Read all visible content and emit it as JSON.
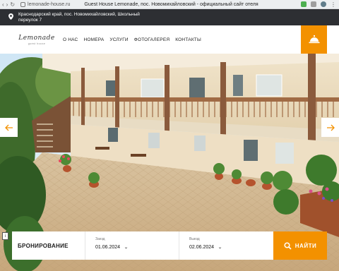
{
  "browser": {
    "url": "lemonade-house.ru",
    "tab_title": "Guest House Lemonade, пос. Новомихайловский - официальный сайт отеля"
  },
  "infobar": {
    "address": "Краснодарский край, пос. Новомихайловский, Школьный переулок 7"
  },
  "logo": {
    "brand": "Lemonade",
    "sub": "guest house"
  },
  "menu": [
    "О НАС",
    "НОМЕРА",
    "УСЛУГИ",
    "ФОТОГАЛЕРЕЯ",
    "КОНТАКТЫ"
  ],
  "booking": {
    "title": "БРОНИРОВАНИЕ",
    "checkin_label": "Заезд",
    "checkin_value": "01.06.2024",
    "checkout_label": "Выезд",
    "checkout_value": "02.06.2024",
    "search_button": "НАЙТИ"
  },
  "info_badge": "i",
  "colors": {
    "accent": "#f39100",
    "infobar": "#2d2f33"
  },
  "icons": [
    "location-pin-icon",
    "bell-icon",
    "chevron-left-icon",
    "chevron-right-icon",
    "chevron-down-icon",
    "search-icon"
  ]
}
